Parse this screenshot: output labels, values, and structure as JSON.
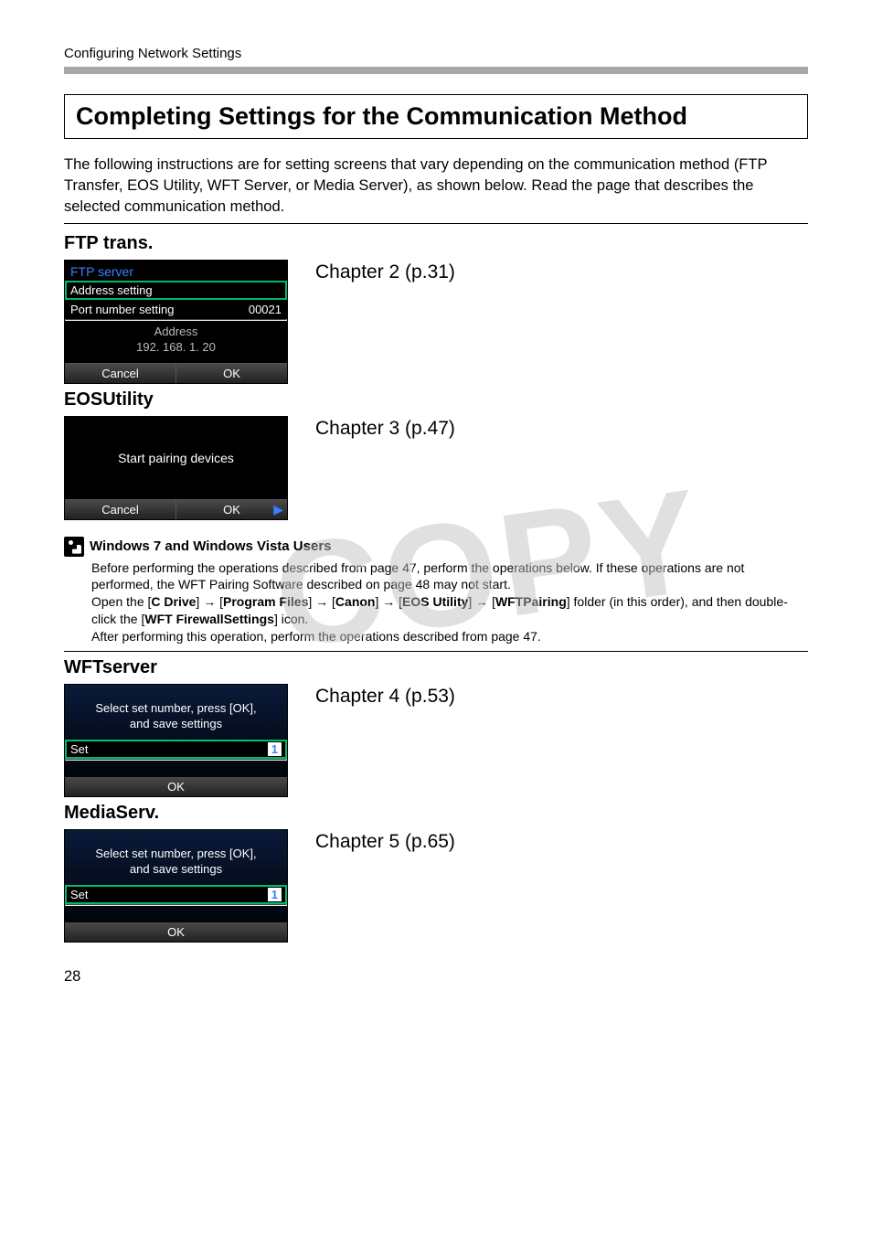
{
  "running_head": "Configuring Network Settings",
  "title": "Completing Settings for the Communication Method",
  "intro": "The following instructions are for setting screens that vary depending on the communication method (FTP Transfer, EOS Utility, WFT Server, or Media Server), as shown below. Read the page that describes the selected communication method.",
  "watermark": "COPY",
  "page_number": "28",
  "sections": {
    "ftp": {
      "heading": "FTP trans.",
      "chapter_ref": "Chapter 2 (p.31)",
      "screen": {
        "title": "FTP server",
        "row_selected": "Address setting",
        "row2_label": "Port number setting",
        "row2_value": "00021",
        "center_label": "Address",
        "center_value": "192. 168. 1. 20",
        "btn_cancel": "Cancel",
        "btn_ok": "OK"
      }
    },
    "eos": {
      "heading": "EOSUtility",
      "chapter_ref": "Chapter 3 (p.47)",
      "screen": {
        "center_text": "Start pairing devices",
        "btn_cancel": "Cancel",
        "btn_ok": "OK"
      }
    },
    "wft": {
      "heading": "WFTserver",
      "chapter_ref": "Chapter 4 (p.53)",
      "screen": {
        "instruction_line1": "Select set number, press [OK],",
        "instruction_line2": "and save settings",
        "set_label": "Set",
        "set_value": "1",
        "btn_ok": "OK"
      }
    },
    "media": {
      "heading": "MediaServ.",
      "chapter_ref": "Chapter 5 (p.65)",
      "screen": {
        "instruction_line1": "Select set number, press [OK],",
        "instruction_line2": "and save settings",
        "set_label": "Set",
        "set_value": "1",
        "btn_ok": "OK"
      }
    }
  },
  "note": {
    "heading": "Windows 7 and Windows Vista Users",
    "line1": "Before performing the operations described from page 47, perform the operations below. If these operations are not performed, the WFT Pairing Software described on page 48 may not start.",
    "open_prefix": "Open the [",
    "c_drive": "C Drive",
    "arrow": " → ",
    "program_files": "Program Files",
    "canon": "Canon",
    "eos_utility": "EOS Utility",
    "wft_pairing": "WFTPairing",
    "open_suffix": "] folder (in this order), and then double-click the [",
    "wft_firewall": "WFT FirewallSettings",
    "icon_suffix": "] icon.",
    "line_last": "After performing this operation, perform the operations described from page 47."
  }
}
